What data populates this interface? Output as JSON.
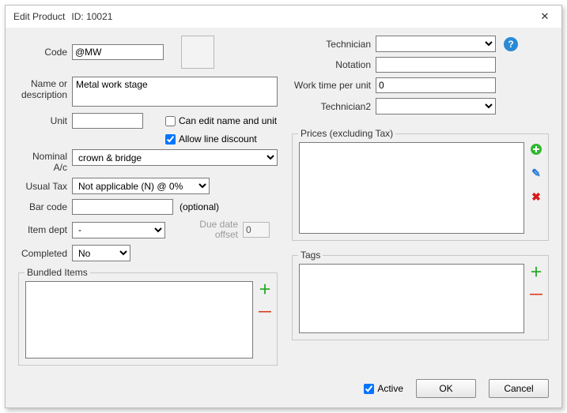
{
  "title": {
    "label": "Edit Product",
    "idlabel": "ID:",
    "id": "10021"
  },
  "left": {
    "code": {
      "label": "Code",
      "value": "@MW"
    },
    "nameDesc": {
      "label": "Name or\ndescription",
      "value": "Metal work stage"
    },
    "unit": {
      "label": "Unit",
      "value": ""
    },
    "canEdit": {
      "label": "Can edit name and unit",
      "checked": false
    },
    "allowDiscount": {
      "label": "Allow line discount",
      "checked": true
    },
    "nominal": {
      "label": "Nominal\nA/c",
      "value": "crown & bridge"
    },
    "usualTax": {
      "label": "Usual Tax",
      "value": "Not applicable (N) @ 0%"
    },
    "barcode": {
      "label": "Bar code",
      "value": "",
      "note": "(optional)"
    },
    "itemDept": {
      "label": "Item dept",
      "value": "-"
    },
    "completed": {
      "label": "Completed",
      "value": "No"
    },
    "dueDate": {
      "label": "Due date\noffset",
      "value": "0"
    },
    "bundled": {
      "legend": "Bundled Items"
    }
  },
  "right": {
    "technician": {
      "label": "Technician",
      "value": ""
    },
    "notation": {
      "label": "Notation",
      "value": ""
    },
    "wtime": {
      "label": "Work time per unit",
      "value": "0"
    },
    "technician2": {
      "label": "Technician2",
      "value": ""
    },
    "prices": {
      "legend": "Prices (excluding Tax)"
    },
    "tags": {
      "legend": "Tags"
    }
  },
  "footer": {
    "active": {
      "label": "Active",
      "checked": true
    },
    "ok": "OK",
    "cancel": "Cancel"
  }
}
